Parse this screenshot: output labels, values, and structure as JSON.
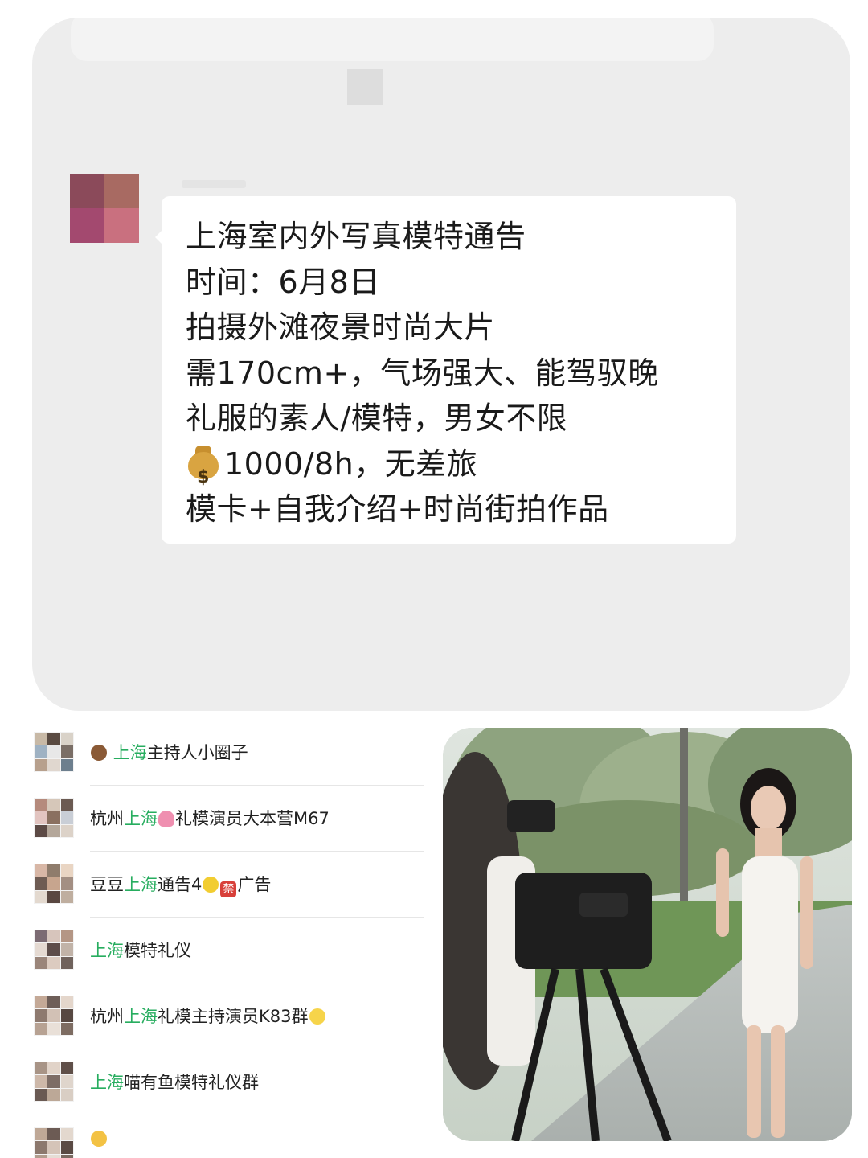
{
  "chat": {
    "message_lines": [
      "上海室内外写真模特通告",
      "时间：6月8日",
      "拍摄外滩夜景时尚大片",
      "需170cm+，气场强大、能驾驭晚",
      "礼服的素人/模特，男女不限",
      "1000/8h，无差旅",
      "模卡+自我介绍+时尚街拍作品"
    ],
    "money_icon": "money-bag-icon"
  },
  "groups": [
    {
      "prefix_icon": "owl-icon",
      "pre": "",
      "highlight": "上海",
      "post": "主持人小圈子"
    },
    {
      "prefix_icon": "",
      "pre": "杭州",
      "highlight": "上海",
      "post_icon": "lotus-icon",
      "post": "礼模演员大本营M67"
    },
    {
      "prefix_icon": "",
      "pre": "豆豆",
      "highlight": "上海",
      "post": "通告4",
      "tail_icons": [
        "moon-icon",
        "prohibited-icon"
      ],
      "tail": "广告"
    },
    {
      "prefix_icon": "",
      "pre": "",
      "highlight": "上海",
      "post": "模特礼仪"
    },
    {
      "prefix_icon": "",
      "pre": "杭州",
      "highlight": "上海",
      "post": "礼模主持演员K83群",
      "tail_icons": [
        "hatching-chick-icon"
      ]
    },
    {
      "prefix_icon": "",
      "pre": "",
      "highlight": "上海",
      "post": "喵有鱼模特礼仪群"
    }
  ],
  "colors": {
    "highlight": "#27ad5f",
    "chat_background": "#ededed",
    "bubble": "#ffffff"
  },
  "photo": {
    "subject": "model in white strapless dress with camera crew outdoors"
  },
  "ban_glyph": "禁"
}
